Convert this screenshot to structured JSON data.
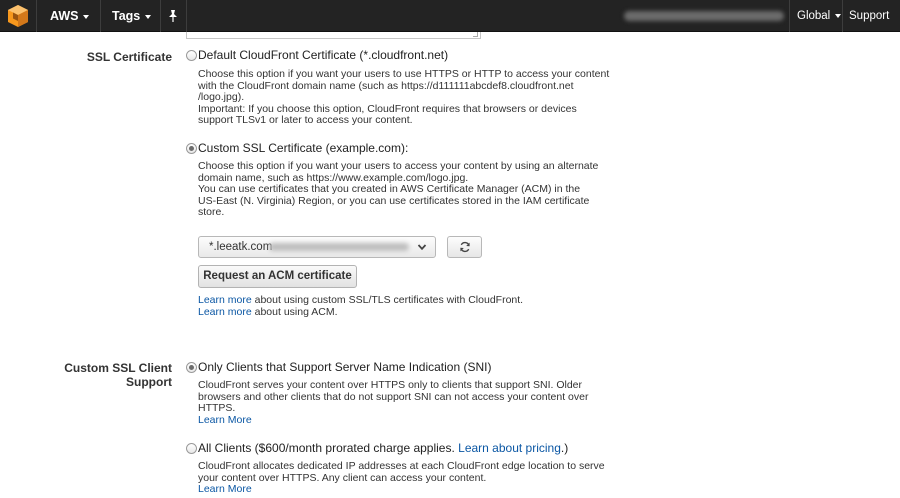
{
  "topbar": {
    "brand": "AWS",
    "tags": "Tags",
    "region": "Global",
    "support": "Support"
  },
  "ssl_certificate": {
    "label": "SSL Certificate",
    "default_option": {
      "title": "Default CloudFront Certificate (*.cloudfront.net)",
      "desc_lines": [
        "Choose this option if you want your users to use HTTPS or HTTP to access your content",
        "with the CloudFront domain name (such as https://d111111abcdef8.cloudfront.net",
        "/logo.jpg).",
        "Important: If you choose this option, CloudFront requires that browsers or devices",
        "support TLSv1 or later to access your content."
      ]
    },
    "custom_option": {
      "title": "Custom SSL Certificate (example.com):",
      "desc_lines": [
        "Choose this option if you want your users to access your content by using an alternate",
        "domain name, such as https://www.example.com/logo.jpg.",
        "You can use certificates that you created in AWS Certificate Manager (ACM) in the",
        "US-East (N. Virginia) Region, or you can use certificates stored in the IAM certificate",
        "store."
      ]
    },
    "selected_certificate": "*.leeatk.com",
    "request_button": "Request an ACM certificate",
    "learn_more_1": "Learn more",
    "learn_more_1_text": " about using custom SSL/TLS certificates with CloudFront.",
    "learn_more_2": "Learn more",
    "learn_more_2_text": " about using ACM."
  },
  "ssl_client_support": {
    "label": "Custom SSL Client Support",
    "sni_option": {
      "title": "Only Clients that Support Server Name Indication (SNI)",
      "desc_lines": [
        "CloudFront serves your content over HTTPS only to clients that support SNI. Older",
        "browsers and other clients that do not support SNI can not access your content over",
        "HTTPS."
      ],
      "learn_more": "Learn More"
    },
    "all_clients_option": {
      "title_prefix": "All Clients ($600/month prorated charge applies. ",
      "pricing_link": "Learn about pricing",
      "title_suffix": ".)",
      "desc_lines": [
        "CloudFront allocates dedicated IP addresses at each CloudFront edge location to serve",
        "your content over HTTPS. Any client can access your content."
      ],
      "learn_more": "Learn More"
    }
  },
  "colors": {
    "topbar_bg": "#232323",
    "link": "#0b57a4",
    "aws_orange": "#f7981d"
  },
  "icons": [
    "aws-logo-icon",
    "pin-icon",
    "chevron-down-icon",
    "refresh-icon"
  ]
}
